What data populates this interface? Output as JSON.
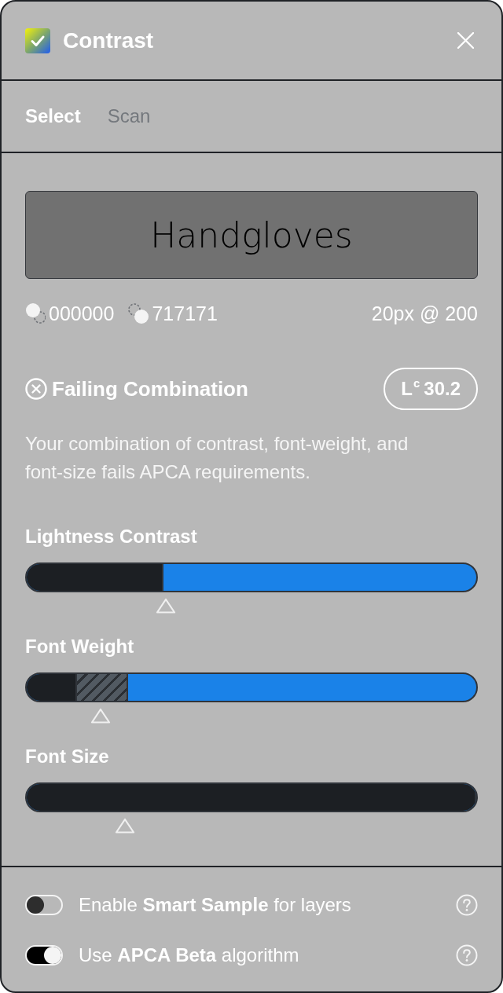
{
  "window": {
    "title": "Contrast"
  },
  "tabs": [
    {
      "label": "Select",
      "selected": true
    },
    {
      "label": "Scan",
      "selected": false
    }
  ],
  "preview": {
    "text": "Handgloves"
  },
  "colors": [
    {
      "kind": "foreground",
      "value": "000000"
    },
    {
      "kind": "background",
      "value": "717171"
    }
  ],
  "font_spec": "20px @ 200",
  "status": {
    "kind": "fail",
    "text": "Failing Combination",
    "score": "L$^{c}$ 30.2",
    "description": "Your combination of contrast, font-weight, and font-size fails APCA requirements."
  },
  "bars": [
    {
      "label": "Lightness Contrast",
      "segments": [
        {
          "kind": "solid",
          "level": 0.304
        }
      ],
      "marker": {
        "level": 0.309
      }
    },
    {
      "label": "Font Weight",
      "segments": [
        {
          "kind": "solid",
          "level": 0.112
        },
        {
          "kind": "hatched",
          "level": 0.113
        }
      ],
      "marker": {
        "level": 0.165
      }
    },
    {
      "label": "Font Size",
      "segments": [
        {
          "kind": "solid",
          "level": 1.0
        }
      ],
      "marker": {
        "level": 0.219
      }
    }
  ],
  "settings": [
    {
      "text": "Enable **Smart Sample** for layers",
      "on": false
    },
    {
      "text": "Use **APCA Beta** algorithm",
      "on": true
    }
  ]
}
